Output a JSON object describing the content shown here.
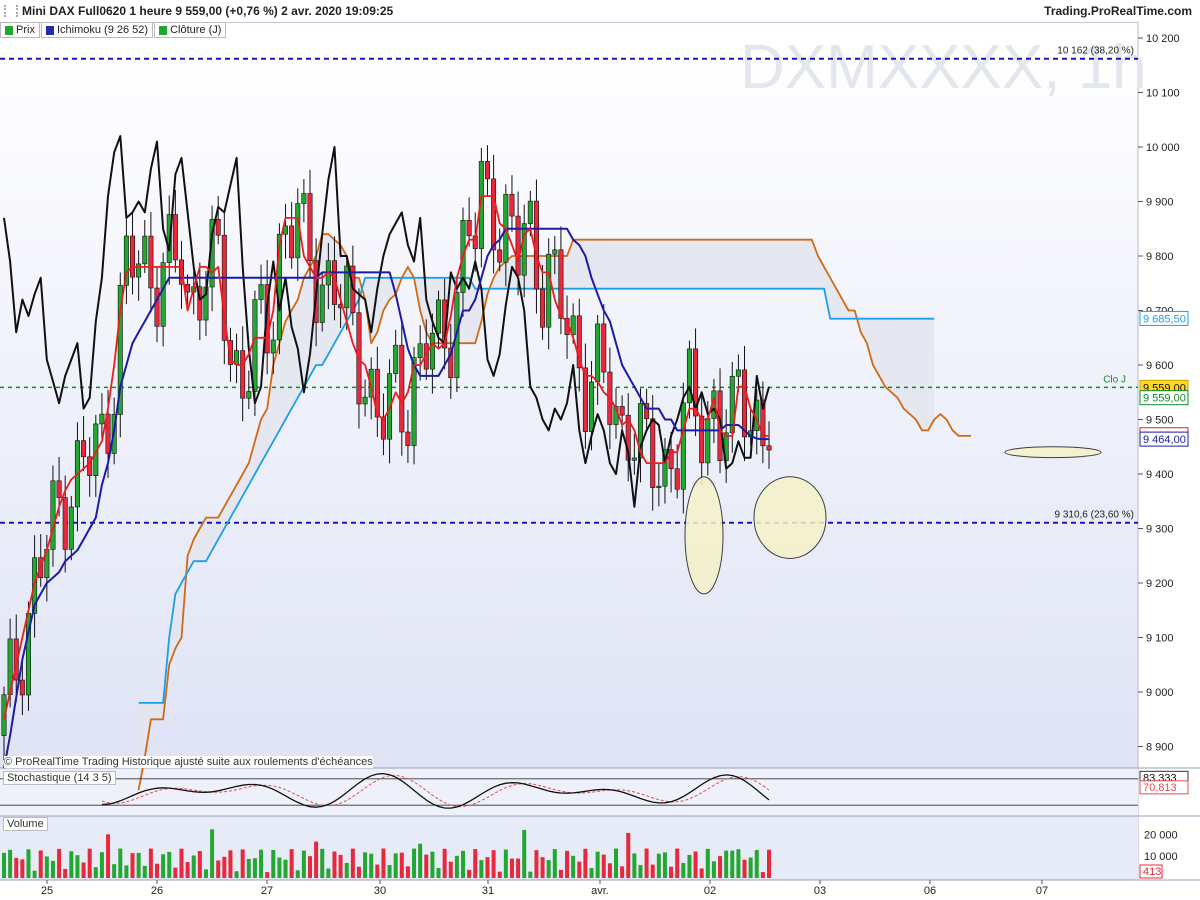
{
  "header": {
    "title": "Mini DAX Full0620 1 heure 9 559,00 (+0,76 %) 2 avr. 2020 19:09:25",
    "site": "Trading.ProRealTime.com"
  },
  "legend": [
    {
      "label": "Prix",
      "color": "#22a830"
    },
    {
      "label": "Ichimoku (9 26 52)",
      "color": "#1f2ea8"
    },
    {
      "label": "Clôture (J)",
      "color": "#22a830"
    }
  ],
  "watermark": "DXMXXXX, 1h",
  "attribution": "© ProRealTime Trading  Historique ajusté suite aux roulements d'échéances",
  "stoch_label": "Stochastique (14 3 5)",
  "volume_label": "Volume",
  "colors": {
    "up": "#22a830",
    "down": "#e8283c",
    "tenkan": "#ee1c1c",
    "kijun": "#1b1ba8",
    "chikou": "#111111",
    "span_a": "#1e9ee8",
    "span_b": "#d06a14",
    "fib": "#1515c8",
    "clo_j": "#138a2c",
    "price_tag": "#ffd820"
  },
  "chart_data": {
    "type": "candlestick",
    "y_ticks": [
      "10 200",
      "10 100",
      "10 000",
      "9 900",
      "9 800",
      "9 700",
      "9 600",
      "9 500",
      "9 400",
      "9 300",
      "9 200",
      "9 100",
      "9 000",
      "8 900"
    ],
    "y_range": [
      8840,
      10240
    ],
    "x_ticks": [
      "25",
      "26",
      "27",
      "30",
      "31",
      "avr.",
      "02",
      "03",
      "06",
      "07"
    ],
    "fib_levels": [
      {
        "label": "10 162 (38,20 %)",
        "value": 10162
      },
      {
        "label": "9 310,6 (23,60 %)",
        "value": 9310.6
      }
    ],
    "clo_j": {
      "label": "Clo J",
      "value": 9559
    },
    "price_tags": [
      {
        "text": "9 685,50",
        "value": 9685.5,
        "kind": "span_a"
      },
      {
        "text": "9 559,00",
        "value": 9559,
        "kind": "last"
      },
      {
        "text": "9 559,00",
        "value": 9540,
        "kind": "clo"
      },
      {
        "text": "9 467,00",
        "value": 9472,
        "kind": "tenkan"
      },
      {
        "text": "9 464,00",
        "value": 9464,
        "kind": "kijun"
      }
    ],
    "highlight_ellipses": [
      {
        "at": "02 low",
        "low": 9180,
        "high": 9395
      },
      {
        "at": "02 late low",
        "low": 9245,
        "high": 9395
      },
      {
        "at": "projected",
        "low": 9430,
        "high": 9450
      }
    ],
    "stochastic": {
      "k": 83.333,
      "d": 70.813,
      "k_label": "83,333",
      "d_label": "70,813"
    },
    "volume_ticks": [
      "20 000",
      "10 000"
    ],
    "volume_last": "413",
    "series": {
      "chikou": [
        9870,
        9790,
        9660,
        9720,
        9690,
        9730,
        9760,
        9610,
        9570,
        9530,
        9580,
        9610,
        9640,
        9520,
        9540,
        9680,
        9760,
        9910,
        9990,
        10020,
        9870,
        9880,
        9900,
        9880,
        9960,
        10010,
        9850,
        9810,
        9950,
        9980,
        9880,
        9780,
        9720,
        9730,
        9840,
        9890,
        9880,
        9930,
        9980,
        9780,
        9630,
        9530,
        9560,
        9710,
        9790,
        9700,
        9760,
        9670,
        9630,
        9550,
        9620,
        9730,
        9840,
        9940,
        10000,
        9800,
        9800,
        9740,
        9730,
        9720,
        9660,
        9740,
        9800,
        9840,
        9860,
        9880,
        9820,
        9790,
        9870,
        9720,
        9680,
        9650,
        9640,
        9770,
        9740,
        9760,
        9740,
        9790,
        9740,
        9610,
        9580,
        9620,
        9710,
        9780,
        9760,
        9700,
        9560,
        9540,
        9500,
        9480,
        9520,
        9500,
        9530,
        9600,
        9480,
        9420,
        9470,
        9510,
        9480,
        9420,
        9400,
        9480,
        9440,
        9340,
        9450,
        9480,
        9500,
        9490,
        9420,
        9470,
        9500,
        9540,
        9560,
        9520,
        9550,
        9510,
        9520,
        9500,
        9410,
        9420,
        9460,
        9430,
        9430,
        9580,
        9520,
        9560
      ],
      "tenkan": [
        8950,
        9000,
        9050,
        9100,
        9150,
        9200,
        9230,
        9260,
        9300,
        9340,
        9370,
        9390,
        9400,
        9410,
        9420,
        9440,
        9460,
        9520,
        9600,
        9700,
        9770,
        9780,
        9780,
        9780,
        9780,
        9780,
        9780,
        9780,
        9780,
        9780,
        9700,
        9740,
        9780,
        9780,
        9770,
        9780,
        9690,
        9610,
        9600,
        9600,
        9620,
        9650,
        9650,
        9650,
        9700,
        9820,
        9870,
        9870,
        9870,
        9800,
        9780,
        9760,
        9760,
        9770,
        9760,
        9720,
        9680,
        9640,
        9610,
        9600,
        9560,
        9510,
        9500,
        9520,
        9550,
        9530,
        9550,
        9600,
        9600,
        9620,
        9640,
        9630,
        9640,
        9690,
        9760,
        9800,
        9830,
        9830,
        9910,
        9910,
        9910,
        9860,
        9850,
        9820,
        9790,
        9840,
        9850,
        9800,
        9770,
        9770,
        9720,
        9690,
        9680,
        9650,
        9610,
        9580,
        9580,
        9570,
        9550,
        9540,
        9520,
        9490,
        9500,
        9480,
        9440,
        9420,
        9420,
        9420,
        9420,
        9440,
        9440,
        9480,
        9520,
        9520,
        9500,
        9500,
        9540,
        9480,
        9470,
        9470,
        9560,
        9560,
        9520,
        9500,
        9470,
        9470
      ],
      "kijun": [
        8860,
        8920,
        8990,
        9060,
        9110,
        9160,
        9180,
        9200,
        9210,
        9220,
        9240,
        9250,
        9260,
        9280,
        9300,
        9320,
        9380,
        9420,
        9480,
        9560,
        9600,
        9640,
        9660,
        9680,
        9700,
        9720,
        9740,
        9760,
        9760,
        9760,
        9760,
        9760,
        9760,
        9760,
        9760,
        9760,
        9760,
        9760,
        9760,
        9760,
        9760,
        9760,
        9760,
        9760,
        9760,
        9760,
        9760,
        9760,
        9760,
        9760,
        9760,
        9760,
        9770,
        9770,
        9770,
        9770,
        9770,
        9770,
        9770,
        9770,
        9770,
        9770,
        9770,
        9770,
        9730,
        9680,
        9630,
        9600,
        9580,
        9580,
        9580,
        9580,
        9600,
        9620,
        9660,
        9700,
        9700,
        9720,
        9760,
        9800,
        9820,
        9830,
        9850,
        9850,
        9850,
        9850,
        9850,
        9850,
        9850,
        9850,
        9850,
        9850,
        9850,
        9830,
        9820,
        9800,
        9760,
        9730,
        9700,
        9680,
        9640,
        9600,
        9580,
        9560,
        9540,
        9520,
        9520,
        9520,
        9500,
        9500,
        9480,
        9480,
        9480,
        9480,
        9480,
        9480,
        9480,
        9480,
        9490,
        9490,
        9490,
        9480,
        9470,
        9465,
        9464,
        9464
      ],
      "span_a": [
        null,
        null,
        null,
        null,
        null,
        null,
        null,
        null,
        null,
        null,
        null,
        null,
        null,
        null,
        null,
        null,
        null,
        null,
        null,
        null,
        null,
        null,
        8980,
        8980,
        8980,
        8980,
        8980,
        9100,
        9180,
        9200,
        9220,
        9240,
        9240,
        9240,
        9260,
        9280,
        9300,
        9320,
        9340,
        9360,
        9380,
        9400,
        9420,
        9440,
        9460,
        9480,
        9500,
        9520,
        9540,
        9560,
        9580,
        9600,
        9600,
        9620,
        9640,
        9660,
        9680,
        9700,
        9720,
        9760,
        9760,
        9760,
        9760,
        9760,
        9760,
        9760,
        9760,
        9760,
        9760,
        9760,
        9760,
        9760,
        9760,
        9760,
        9760,
        9760,
        9760,
        9740,
        9740,
        9740,
        9740,
        9740,
        9740,
        9740,
        9740,
        9740,
        9740,
        9740,
        9740,
        9740,
        9740,
        9740,
        9740,
        9740,
        9740,
        9740,
        9740,
        9740,
        9740,
        9740,
        9740,
        9740,
        9740,
        9740,
        9740,
        9740,
        9740,
        9740,
        9740,
        9740,
        9740,
        9740,
        9740,
        9740,
        9740,
        9740,
        9740,
        9740,
        9740,
        9740,
        9740,
        9740,
        9740,
        9740,
        9740,
        9740,
        9740,
        9740,
        9740,
        9740,
        9740,
        9740,
        9740,
        9740,
        9740,
        9685,
        9685,
        9685,
        9685,
        9685,
        9685,
        9685,
        9685,
        9685,
        9685,
        9685,
        9685,
        9685,
        9685,
        9685,
        9685,
        9685,
        9685
      ],
      "span_b": [
        null,
        null,
        null,
        null,
        null,
        null,
        null,
        null,
        null,
        null,
        null,
        null,
        null,
        null,
        null,
        null,
        null,
        null,
        null,
        null,
        null,
        null,
        8820,
        8880,
        8950,
        8950,
        8950,
        9050,
        9080,
        9100,
        9250,
        9280,
        9300,
        9320,
        9320,
        9320,
        9340,
        9360,
        9380,
        9400,
        9420,
        9460,
        9500,
        9520,
        9600,
        9640,
        9680,
        9700,
        9720,
        9760,
        9780,
        9800,
        9840,
        9840,
        9830,
        9820,
        9800,
        9760,
        9760,
        9720,
        9640,
        9660,
        9700,
        9720,
        9730,
        9760,
        9780,
        9760,
        9700,
        9660,
        9640,
        9640,
        9640,
        9640,
        9640,
        9640,
        9640,
        9640,
        9680,
        9730,
        9760,
        9780,
        9790,
        9800,
        9800,
        9800,
        9800,
        9800,
        9800,
        9800,
        9800,
        9800,
        9800,
        9830,
        9830,
        9830,
        9830,
        9830,
        9830,
        9830,
        9830,
        9830,
        9830,
        9830,
        9830,
        9830,
        9830,
        9830,
        9830,
        9830,
        9830,
        9830,
        9830,
        9830,
        9830,
        9830,
        9830,
        9830,
        9830,
        9830,
        9830,
        9830,
        9830,
        9830,
        9830,
        9830,
        9830,
        9830,
        9830,
        9830,
        9830,
        9830,
        9830,
        9800,
        9780,
        9760,
        9740,
        9720,
        9700,
        9700,
        9660,
        9640,
        9600,
        9580,
        9560,
        9550,
        9540,
        9520,
        9510,
        9500,
        9480,
        9480,
        9500,
        9510,
        9500,
        9480,
        9470,
        9470,
        9470
      ]
    }
  }
}
